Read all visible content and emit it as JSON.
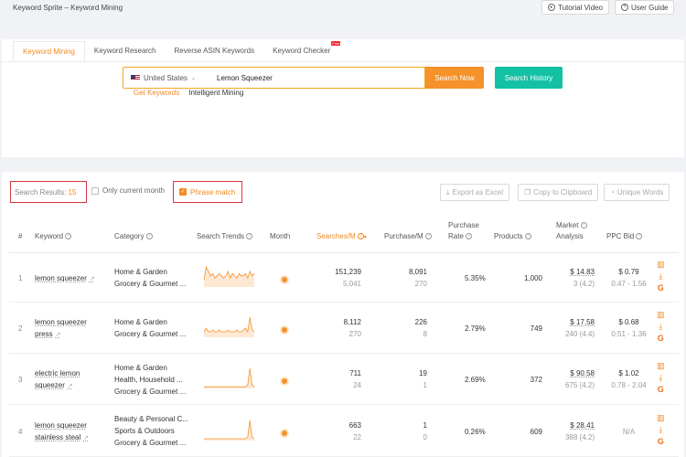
{
  "app": {
    "title": "Keyword Sprite – Keyword Mining"
  },
  "top_buttons": {
    "tutorial": "Tutorial Video",
    "guide": "User Guide"
  },
  "tabs": [
    {
      "label": "Keyword Mining"
    },
    {
      "label": "Keyword Research"
    },
    {
      "label": "Reverse ASIN Keywords"
    },
    {
      "label": "Keyword Checker"
    }
  ],
  "tab_badge": "Free",
  "subtabs": [
    {
      "label": "Get Keywords"
    },
    {
      "label": "Intelligent Mining"
    }
  ],
  "search": {
    "country": "United States",
    "keyword": "Lemon Squeezer",
    "search_now": "Search Now",
    "search_history": "Search History"
  },
  "results": {
    "label": "Search Results:",
    "count": "15"
  },
  "filters": {
    "only_current_month": "Only current month",
    "phrase_match": "Phrase match"
  },
  "actions": {
    "export": "Export as Excel",
    "copy": "Copy to Clipboard",
    "unique": "Unique Words"
  },
  "columns": {
    "index": "#",
    "keyword": "Keyword",
    "category": "Category",
    "trends": "Search Trends",
    "month": "Month",
    "searches": "Searches/M",
    "purchases": "Purchase/M",
    "purchase_rate_1": "Purchase",
    "purchase_rate_2": "Rate",
    "products": "Products",
    "market_1": "Market",
    "market_2": "Analysis",
    "ppc": "PPC Bid"
  },
  "rows": [
    {
      "index": "1",
      "keyword": [
        "lemon squeezer"
      ],
      "category": [
        "Home & Garden",
        "Grocery & Gourmet ..."
      ],
      "trend": [
        3,
        9,
        7,
        5,
        6,
        4,
        5,
        6,
        5,
        4,
        5,
        7,
        4,
        6,
        5,
        4,
        6,
        5,
        5,
        6,
        4,
        7,
        5,
        6
      ],
      "searches": "151,239",
      "searches_sub": "5,041",
      "purchases": "8,091",
      "purchases_sub": "270",
      "purchase_rate": "5.35%",
      "products": "1,000",
      "market": "$ 14.83",
      "market_sub": "3 (4.2)",
      "ppc": "$ 0.79",
      "ppc_sub": "0.47 - 1.56"
    },
    {
      "index": "2",
      "keyword": [
        "lemon squeezer",
        "press"
      ],
      "category": [
        "Home & Garden",
        "Grocery & Gourmet ..."
      ],
      "trend": [
        3,
        5,
        3,
        3,
        4,
        3,
        3,
        4,
        3,
        3,
        3,
        4,
        3,
        3,
        3,
        4,
        3,
        3,
        4,
        5,
        3,
        11,
        4,
        3
      ],
      "searches": "8,112",
      "searches_sub": "270",
      "purchases": "226",
      "purchases_sub": "8",
      "purchase_rate": "2.79%",
      "products": "749",
      "market": "$ 17.58",
      "market_sub": "240 (4.4)",
      "ppc": "$ 0.68",
      "ppc_sub": "0.51 - 1.36"
    },
    {
      "index": "3",
      "keyword": [
        "electric lemon",
        "squeezer"
      ],
      "category": [
        "Home & Garden",
        "Health, Household ...",
        "Grocery & Gourmet ..."
      ],
      "trend": [
        1,
        1,
        1,
        1,
        1,
        1,
        1,
        1,
        1,
        1,
        1,
        1,
        1,
        1,
        1,
        1,
        1,
        1,
        1,
        1,
        2,
        12,
        2,
        1
      ],
      "searches": "711",
      "searches_sub": "24",
      "purchases": "19",
      "purchases_sub": "1",
      "purchase_rate": "2.69%",
      "products": "372",
      "market": "$ 90.58",
      "market_sub": "675 (4.2)",
      "ppc": "$ 1.02",
      "ppc_sub": "0.78 - 2.04"
    },
    {
      "index": "4",
      "keyword": [
        "lemon squeezer",
        "stainless steal"
      ],
      "category": [
        "Beauty & Personal C...",
        "Sports & Outdoors",
        "Grocery & Gourmet ..."
      ],
      "trend": [
        1,
        1,
        1,
        1,
        1,
        1,
        1,
        1,
        1,
        1,
        1,
        1,
        1,
        1,
        1,
        1,
        1,
        1,
        1,
        1,
        2,
        11,
        2,
        1
      ],
      "searches": "663",
      "searches_sub": "22",
      "purchases": "1",
      "purchases_sub": "0",
      "purchase_rate": "0.26%",
      "products": "609",
      "market": "$ 28.41",
      "market_sub": "388 (4.2)",
      "ppc": "N/A",
      "ppc_sub": ""
    }
  ],
  "colors": {
    "accent": "#f5922a",
    "teal": "#14c1a4",
    "highlight_border": "#d9363e"
  }
}
